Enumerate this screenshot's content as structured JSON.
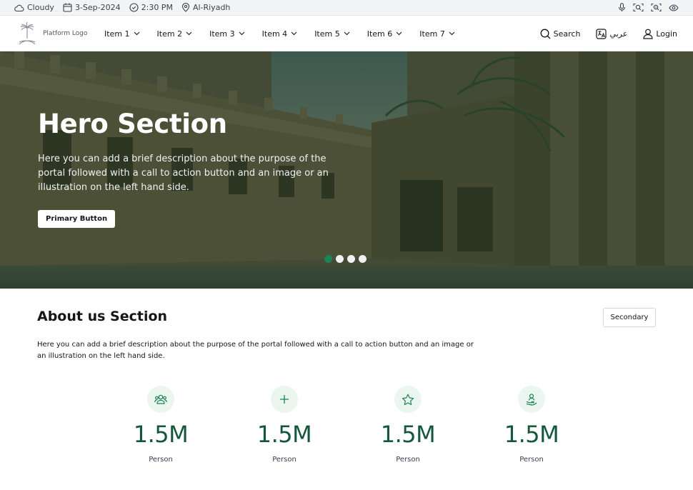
{
  "topbar": {
    "weather": "Cloudy",
    "date": "3-Sep-2024",
    "time": "2:30 PM",
    "location": "Al-Riyadh",
    "icons": [
      "microphone-icon",
      "zoom-in-icon",
      "zoom-out-icon",
      "eye-icon"
    ]
  },
  "nav": {
    "logo_text": "Platform Logo",
    "items": [
      {
        "label": "Item  1"
      },
      {
        "label": "Item 2"
      },
      {
        "label": "Item 3"
      },
      {
        "label": "Item 4"
      },
      {
        "label": "Item 5"
      },
      {
        "label": "Item 6"
      },
      {
        "label": "Item 7"
      }
    ],
    "search_label": "Search",
    "language_label": "عربي",
    "login_label": "Login"
  },
  "hero": {
    "title": "Hero Section",
    "description": "Here you can add a brief description about the purpose of the portal followed with a call to action button and an image or an illustration on the left hand side.",
    "primary_button": "Primary Button",
    "slides": 4,
    "active_slide": 1
  },
  "about": {
    "title": "About us Section",
    "secondary_button": "Secondary",
    "description": "Here you can add a brief description about the purpose of the portal followed with a call to action button and an image or an illustration on the left hand side.",
    "stats": [
      {
        "icon": "users-icon",
        "value": "1.5M",
        "label": "Person"
      },
      {
        "icon": "plus-icon",
        "value": "1.5M",
        "label": "Person"
      },
      {
        "icon": "star-icon",
        "value": "1.5M",
        "label": "Person"
      },
      {
        "icon": "hand-user-icon",
        "value": "1.5M",
        "label": "Person"
      }
    ]
  },
  "colors": {
    "brand": "#1b8354",
    "brand_dark": "#14573a",
    "icon_bg": "#ecf6f0"
  }
}
